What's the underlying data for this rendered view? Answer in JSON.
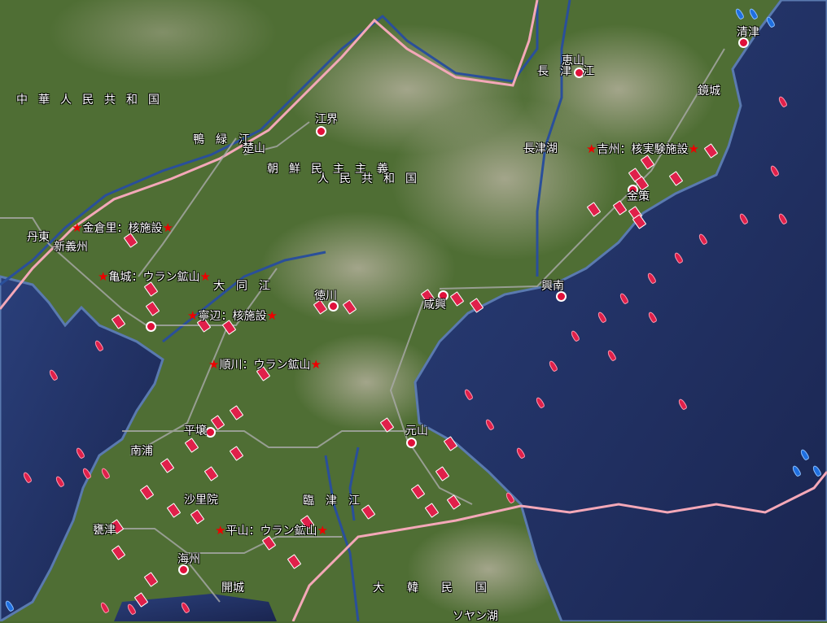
{
  "map": {
    "countries": {
      "china": "中華人民共和国",
      "north_korea_1": "朝鮮民主主義",
      "north_korea_2": "人民共和国",
      "south_korea": "大韓民国"
    },
    "rivers": {
      "yalu": "鴨緑江",
      "taedong": "大同江",
      "imjin": "臨津江",
      "changjin": "長津江"
    },
    "lakes": {
      "changjin_lake": "長津湖",
      "soyang_lake": "ソヤン湖"
    },
    "cities": {
      "chosan": "楚山",
      "kanggye": "江界",
      "hyesan": "恵山",
      "chongjin": "清津",
      "kyongsong": "鏡城",
      "kimchaek": "金策",
      "hungnam": "興南",
      "dandong": "丹東",
      "sinuiju": "新義州",
      "tokchon": "徳川",
      "hamhung": "咸興",
      "wonsan": "元山",
      "pyongyang": "平壌",
      "nampo": "南浦",
      "sariwon": "沙里院",
      "ongjin": "甕津",
      "haeju": "海州",
      "kaesong": "開城"
    },
    "facilities": {
      "kumchangri": "金倉里：核施設",
      "kusong": "亀城：ウラン鉱山",
      "yongbyon": "寧辺：核施設",
      "sunchon": "順川：ウラン鉱山",
      "kilju": "吉州：核実験施設",
      "pyongsan": "平山：ウラン鉱山"
    },
    "colors": {
      "sea": "#1c2a5a",
      "land": "#4f6e34",
      "unit": "#e0204a",
      "allied_unit": "#1f6fe0",
      "river": "#2a4f9a",
      "border": "#f0a0b0"
    }
  }
}
